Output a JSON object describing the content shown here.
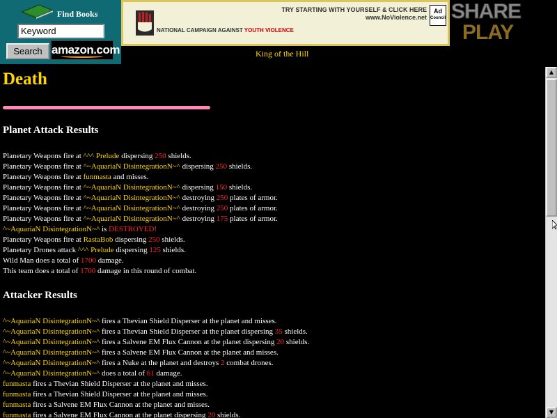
{
  "amazon": {
    "find_label": "Find Books",
    "keyword_value": "Keyword",
    "search_label": "Search",
    "logo_text": "amazon.com"
  },
  "ad": {
    "slogan_line1": "TRY STARTING WITH YOURSELF & CLICK HERE",
    "slogan_line2": "www.NoViolence.net",
    "org_text": "NATIONAL CAMPAIGN AGAINST",
    "org_highlight": "YOUTH VIOLENCE",
    "adcouncil_line1": "Ad",
    "adcouncil_line2": "Council"
  },
  "shareplay": {
    "line1": "SHARE",
    "line2": "PLAY"
  },
  "banner_link": "King of the Hill",
  "page": {
    "title": "Death",
    "section1_title": "Planet Attack Results",
    "section2_title": "Attacker Results"
  },
  "planet_attack": [
    [
      [
        "w",
        "Planetary Weapons fire at "
      ],
      [
        "y",
        "^^^ Prelude"
      ],
      [
        "w",
        " dispersing "
      ],
      [
        "r",
        "250"
      ],
      [
        "w",
        " shields."
      ]
    ],
    [
      [
        "w",
        "Planetary Weapons fire at "
      ],
      [
        "y",
        "^~AquariaN DisintegrationN~^"
      ],
      [
        "w",
        " dispersing "
      ],
      [
        "r",
        "250"
      ],
      [
        "w",
        " shields."
      ]
    ],
    [
      [
        "w",
        "Planetary Weapons fire at "
      ],
      [
        "y",
        "funmasta"
      ],
      [
        "w",
        " and misses."
      ]
    ],
    [
      [
        "w",
        "Planetary Weapons fire at "
      ],
      [
        "y",
        "^~AquariaN DisintegrationN~^"
      ],
      [
        "w",
        " dispersing "
      ],
      [
        "r",
        "150"
      ],
      [
        "w",
        " shields."
      ]
    ],
    [
      [
        "w",
        "Planetary Weapons fire at "
      ],
      [
        "y",
        "^~AquariaN DisintegrationN~^"
      ],
      [
        "w",
        " destroying "
      ],
      [
        "r",
        "250"
      ],
      [
        "w",
        " plates of armor."
      ]
    ],
    [
      [
        "w",
        "Planetary Weapons fire at "
      ],
      [
        "y",
        "^~AquariaN DisintegrationN~^"
      ],
      [
        "w",
        " destroying "
      ],
      [
        "r",
        "250"
      ],
      [
        "w",
        " plates of armor."
      ]
    ],
    [
      [
        "w",
        "Planetary Weapons fire at "
      ],
      [
        "y",
        "^~AquariaN DisintegrationN~^"
      ],
      [
        "w",
        " destroying "
      ],
      [
        "r",
        "175"
      ],
      [
        "w",
        " plates of armor."
      ]
    ],
    [
      [
        "y",
        "^~AquariaN DisintegrationN~^"
      ],
      [
        "w",
        " is "
      ],
      [
        "r",
        "DESTROYED!"
      ]
    ],
    [
      [
        "w",
        "Planetary Weapons fire at "
      ],
      [
        "y",
        "RastaBob"
      ],
      [
        "w",
        " dispersing "
      ],
      [
        "r",
        "250"
      ],
      [
        "w",
        " shields."
      ]
    ],
    [
      [
        "w",
        "Planetary Drones attack "
      ],
      [
        "y",
        "^^^ Prelude"
      ],
      [
        "w",
        " dispersing "
      ],
      [
        "r",
        "125"
      ],
      [
        "w",
        " shields."
      ]
    ],
    [
      [
        "w",
        "Wild Man does a total of "
      ],
      [
        "r",
        "1700"
      ],
      [
        "w",
        " damage."
      ]
    ],
    [
      [
        "w",
        "This team does a total of "
      ],
      [
        "r",
        "1700"
      ],
      [
        "w",
        " damage in this round of combat."
      ]
    ]
  ],
  "attacker_results": [
    [
      [
        "y",
        "^~AquariaN DisintegrationN~^"
      ],
      [
        "w",
        " fires a Thevian Shield Disperser at the planet and misses."
      ]
    ],
    [
      [
        "y",
        "^~AquariaN DisintegrationN~^"
      ],
      [
        "w",
        " fires a Thevian Shield Disperser at the planet dispersing "
      ],
      [
        "r",
        "35"
      ],
      [
        "w",
        " shields."
      ]
    ],
    [
      [
        "y",
        "^~AquariaN DisintegrationN~^"
      ],
      [
        "w",
        " fires a Salvene EM Flux Cannon at the planet dispersing "
      ],
      [
        "r",
        "20"
      ],
      [
        "w",
        " shields."
      ]
    ],
    [
      [
        "y",
        "^~AquariaN DisintegrationN~^"
      ],
      [
        "w",
        " fires a Salvene EM Flux Cannon at the planet and misses."
      ]
    ],
    [
      [
        "y",
        "^~AquariaN DisintegrationN~^"
      ],
      [
        "w",
        " fires a Nuke at the planet and destroys "
      ],
      [
        "r",
        "2"
      ],
      [
        "w",
        " combat drones."
      ]
    ],
    [
      [
        "y",
        "^~AquariaN DisintegrationN~^"
      ],
      [
        "w",
        " does a total of "
      ],
      [
        "r",
        "61"
      ],
      [
        "w",
        " damage."
      ]
    ],
    [
      [
        "y",
        "funmasta"
      ],
      [
        "w",
        " fires a Thevian Shield Disperser at the planet and misses."
      ]
    ],
    [
      [
        "y",
        "funmasta"
      ],
      [
        "w",
        " fires a Thevian Shield Disperser at the planet and misses."
      ]
    ],
    [
      [
        "y",
        "funmasta"
      ],
      [
        "w",
        " fires a Salvene EM Flux Cannon at the planet and misses."
      ]
    ],
    [
      [
        "y",
        "funmasta"
      ],
      [
        "w",
        " fires a Salvene EM Flux Cannon at the planet dispersing "
      ],
      [
        "r",
        "20"
      ],
      [
        "w",
        " shields."
      ]
    ]
  ],
  "colors": {
    "highlight": "#ffd700",
    "number": "#ff2a2a",
    "text": "#ffffff",
    "background": "#000000",
    "rule": "#ff88b8"
  },
  "scrollbar": {
    "position_fraction": 0.0
  }
}
